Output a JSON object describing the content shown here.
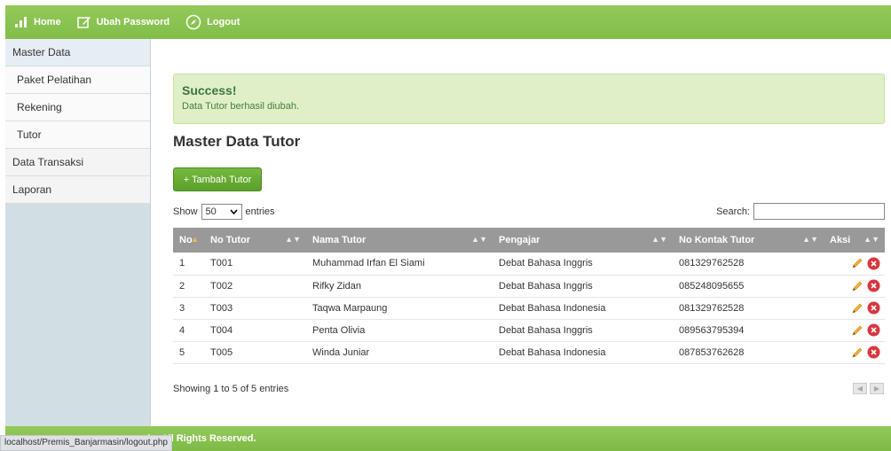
{
  "topbar": {
    "home": "Home",
    "ubah_password": "Ubah Password",
    "logout": "Logout"
  },
  "sidebar": {
    "master_data": "Master Data",
    "items": [
      "Paket Pelatihan",
      "Rekening",
      "Tutor"
    ],
    "data_transaksi": "Data Transaksi",
    "laporan": "Laporan"
  },
  "alert": {
    "title": "Success!",
    "text": "Data Tutor berhasil diubah."
  },
  "page_title": "Master Data Tutor",
  "add_button": "+ Tambah Tutor",
  "table_controls": {
    "show": "Show",
    "entries_value": "50",
    "entries": "entries",
    "search": "Search:"
  },
  "table": {
    "headers": [
      "No",
      "No Tutor",
      "Nama Tutor",
      "Pengajar",
      "No Kontak Tutor",
      "Aksi"
    ],
    "rows": [
      [
        "1",
        "T001",
        "Muhammad Irfan El Siami",
        "Debat Bahasa Inggris",
        "081329762528"
      ],
      [
        "2",
        "T002",
        "Rifky Zidan",
        "Debat Bahasa Inggris",
        "085248095655"
      ],
      [
        "3",
        "T003",
        "Taqwa Marpaung",
        "Debat Bahasa Indonesia",
        "081329762528"
      ],
      [
        "4",
        "T004",
        "Penta Olivia",
        "Debat Bahasa Inggris",
        "089563795394"
      ],
      [
        "5",
        "T005",
        "Winda Juniar",
        "Debat Bahasa Indonesia",
        "087853762628"
      ]
    ]
  },
  "info": "Showing 1 to 5 of 5 entries",
  "footer": "sin. All Rights Reserved.",
  "statusbar": "localhost/Premis_Banjarmasin/logout.php",
  "colors": {
    "topbar": "#8bc34a",
    "sidebar": "#d1dfe5",
    "alert_bg": "#dff0c8",
    "table_header": "#999999",
    "button": "#5aa02a"
  }
}
